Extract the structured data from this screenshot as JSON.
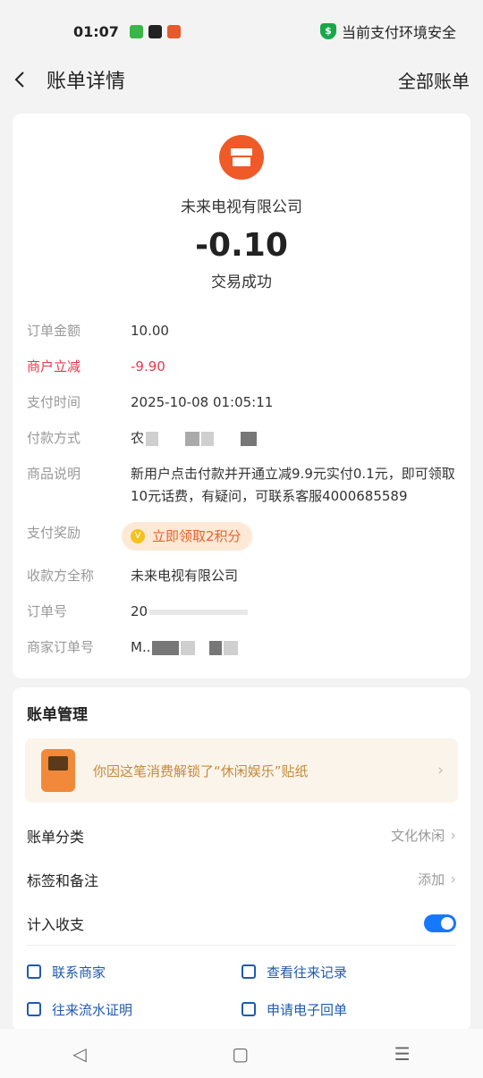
{
  "status_bar": {
    "time": "01:07",
    "security_text": "当前支付环境安全",
    "icons": [
      "message-app-icon",
      "game-app-icon",
      "taobao-app-icon"
    ]
  },
  "header": {
    "title": "账单详情",
    "all_bills": "全部账单"
  },
  "summary": {
    "merchant_name": "未来电视有限公司",
    "amount": "-0.10",
    "status": "交易成功"
  },
  "details": {
    "order_amount_label": "订单金额",
    "order_amount": "10.00",
    "discount_label": "商户立减",
    "discount": "-9.90",
    "pay_time_label": "支付时间",
    "pay_time": "2025-10-08 01:05:11",
    "pay_method_label": "付款方式",
    "pay_method_visible": "农",
    "goods_label": "商品说明",
    "goods_desc": "新用户点击付款并开通立减9.9元实付0.1元，即可领取10元话费，有疑问，可联系客服4000685589",
    "reward_label": "支付奖励",
    "reward_text": "立即领取2积分",
    "payee_label": "收款方全称",
    "payee": "未来电视有限公司",
    "order_no_label": "订单号",
    "order_no_visible": "20",
    "merchant_order_label": "商家订单号",
    "merchant_order_visible": "M.."
  },
  "management": {
    "title": "账单管理",
    "sticker_text": "你因这笔消费解锁了“休闲娱乐”贴纸",
    "category_label": "账单分类",
    "category_value": "文化休闲",
    "tag_label": "标签和备注",
    "tag_value": "添加",
    "include_label": "计入收支",
    "include_on": true,
    "links": {
      "contact": "联系商家",
      "history": "查看往来记录",
      "statement": "往来流水证明",
      "receipt": "申请电子回单"
    }
  },
  "nav": {
    "back": "◁",
    "home": "▢",
    "menu": "☰"
  },
  "colors": {
    "accent_blue": "#1677ff",
    "discount_red": "#e8384c",
    "merchant_orange": "#ef5a28",
    "secure_green": "#19a74a"
  }
}
